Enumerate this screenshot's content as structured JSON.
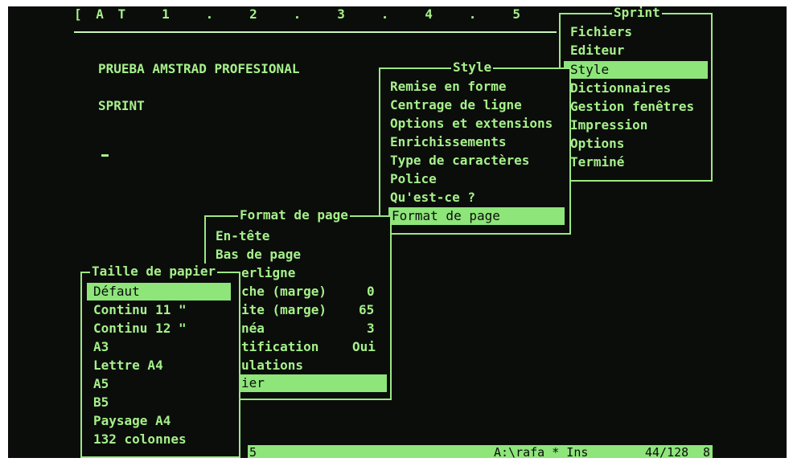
{
  "ruler": "[ A T   1   .   2   .   3   .   4   .   5   .",
  "document": {
    "line1": "PRUEBA AMSTRAD PROFESIONAL",
    "line2": "SPRINT"
  },
  "sprint_menu": {
    "title": "Sprint",
    "items": [
      "Fichiers",
      "Editeur",
      "Style",
      "Dictionnaires",
      "Gestion fenêtres",
      "Impression",
      "Options",
      "Terminé"
    ]
  },
  "style_menu": {
    "title": "Style",
    "items": [
      "Remise en forme",
      "Centrage de ligne",
      "Options et extensions",
      "Enrichissements",
      "Type de caractères",
      "Police",
      "Qu'est-ce ?",
      "Format de page"
    ]
  },
  "format_menu": {
    "title": "Format de page",
    "items": [
      {
        "label": "En-tête",
        "value": ""
      },
      {
        "label": "Bas de page",
        "value": ""
      },
      {
        "label": "erligne",
        "value": ""
      },
      {
        "label": "che (marge)",
        "value": "0"
      },
      {
        "label": "ite (marge)",
        "value": "65"
      },
      {
        "label": "néa",
        "value": "3"
      },
      {
        "label": "tification",
        "value": "Oui"
      },
      {
        "label": "ulations",
        "value": ""
      },
      {
        "label": "ier",
        "value": ""
      }
    ]
  },
  "paper_menu": {
    "title": "Taille de papier",
    "items": [
      "Défaut",
      "Continu 11 \"",
      "Continu 12 \"",
      "A3",
      "Lettre A4",
      "A5",
      "B5",
      "Paysage A4",
      "132 colonnes"
    ]
  },
  "status_bar": {
    "left": "5",
    "path": "A:\\rafa * Ins",
    "position": "44/128",
    "right": "8"
  },
  "colors": {
    "phosphor": "#a6f08a",
    "highlight": "#8ee57a",
    "background": "#0b0d0b"
  }
}
